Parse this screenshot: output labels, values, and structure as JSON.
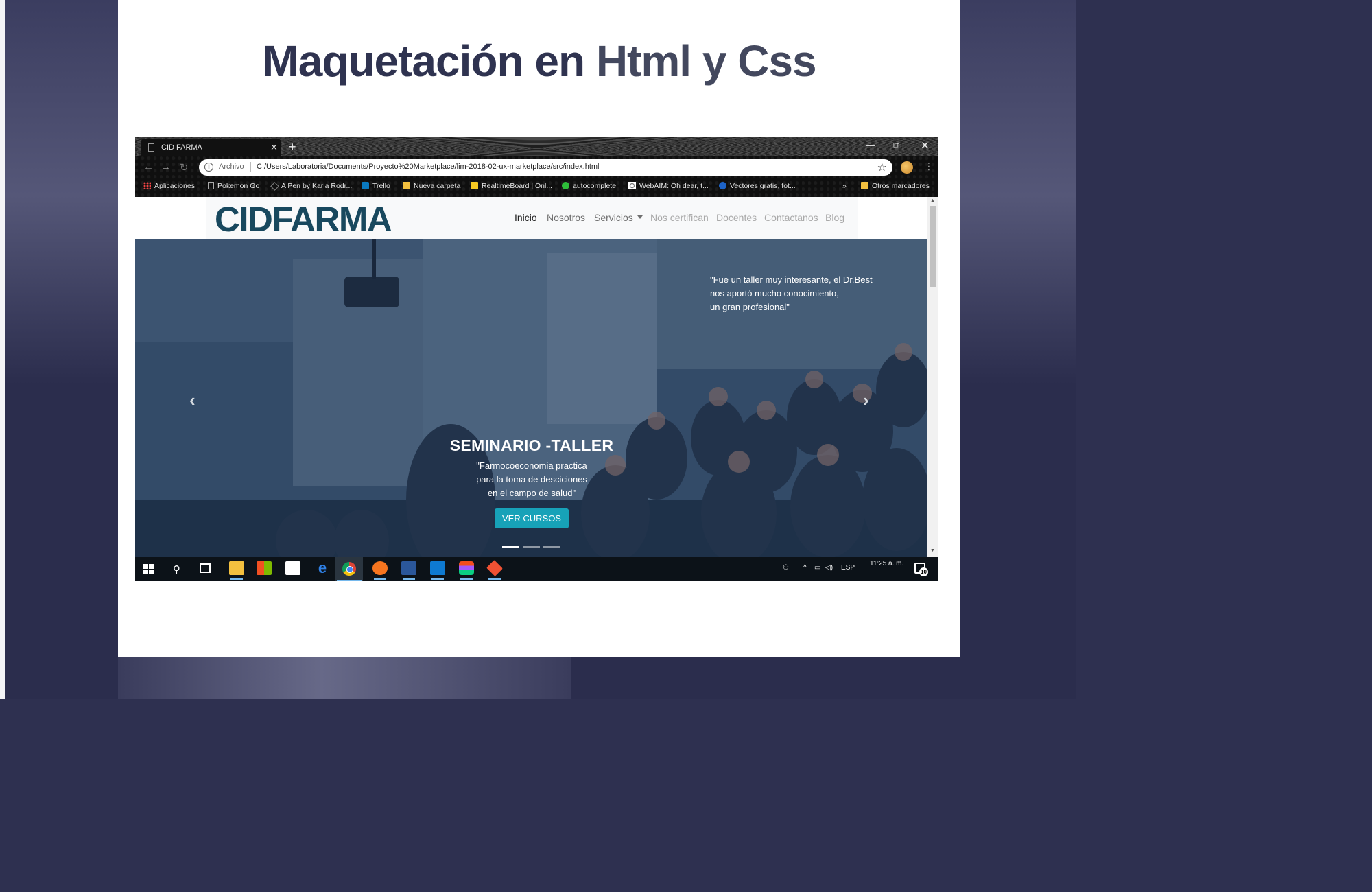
{
  "slide": {
    "title_part1": "Maquetación en ",
    "title_part2": "Html y Css"
  },
  "browser": {
    "tab_title": "CID FARMA",
    "address_protocol": "Archivo",
    "address_url": "C:/Users/Laboratoria/Documents/Proyecto%20Marketplace/lim-2018-02-ux-marketplace/src/index.html",
    "bookmarks": [
      {
        "label": "Aplicaciones",
        "icon": "apps-grid-icon"
      },
      {
        "label": "Pokemon Go",
        "icon": "page-icon"
      },
      {
        "label": "A Pen by Karla Rodr...",
        "icon": "codepen-icon"
      },
      {
        "label": "Trello",
        "icon": "trello-icon"
      },
      {
        "label": "Nueva carpeta",
        "icon": "folder-icon"
      },
      {
        "label": "RealtimeBoard | Onl...",
        "icon": "realtimeboard-icon"
      },
      {
        "label": "autocomplete",
        "icon": "autocomplete-icon"
      },
      {
        "label": "WebAIM: Oh dear, t...",
        "icon": "webaim-icon"
      },
      {
        "label": "Vectores gratis, fot...",
        "icon": "vectors-icon"
      },
      {
        "label": "»",
        "icon": ""
      },
      {
        "label": "Otros marcadores",
        "icon": "folder-icon"
      }
    ]
  },
  "site": {
    "logo": "CIDFARMA",
    "nav": {
      "inicio": "Inicio",
      "nosotros": "Nosotros",
      "servicios": "Servicios",
      "certifican": "Nos certifican",
      "docentes": "Docentes",
      "contactanos": "Contactanos",
      "blog": "Blog"
    },
    "hero": {
      "quote_line1": "\"Fue un taller muy interesante, el Dr.Best",
      "quote_line2": "nos aportó mucho conocimiento,",
      "quote_line3": "un gran profesional\"",
      "caption_title": "SEMINARIO -TALLER",
      "caption_line1": "\"Farmocoeconomia practica",
      "caption_line2": "para la toma de desciciones",
      "caption_line3": "en el campo de salud\"",
      "cta_label": "VER CURSOS",
      "slides_count": 3,
      "active_slide": 1
    }
  },
  "taskbar": {
    "tray_lang": "ESP",
    "clock_time": "11:25 a. m.",
    "notification_count": "10"
  },
  "colors": {
    "title": "#2f3350",
    "logo": "#18485e",
    "cta": "#17a2b8",
    "nav_bg": "#f8f9fa"
  }
}
